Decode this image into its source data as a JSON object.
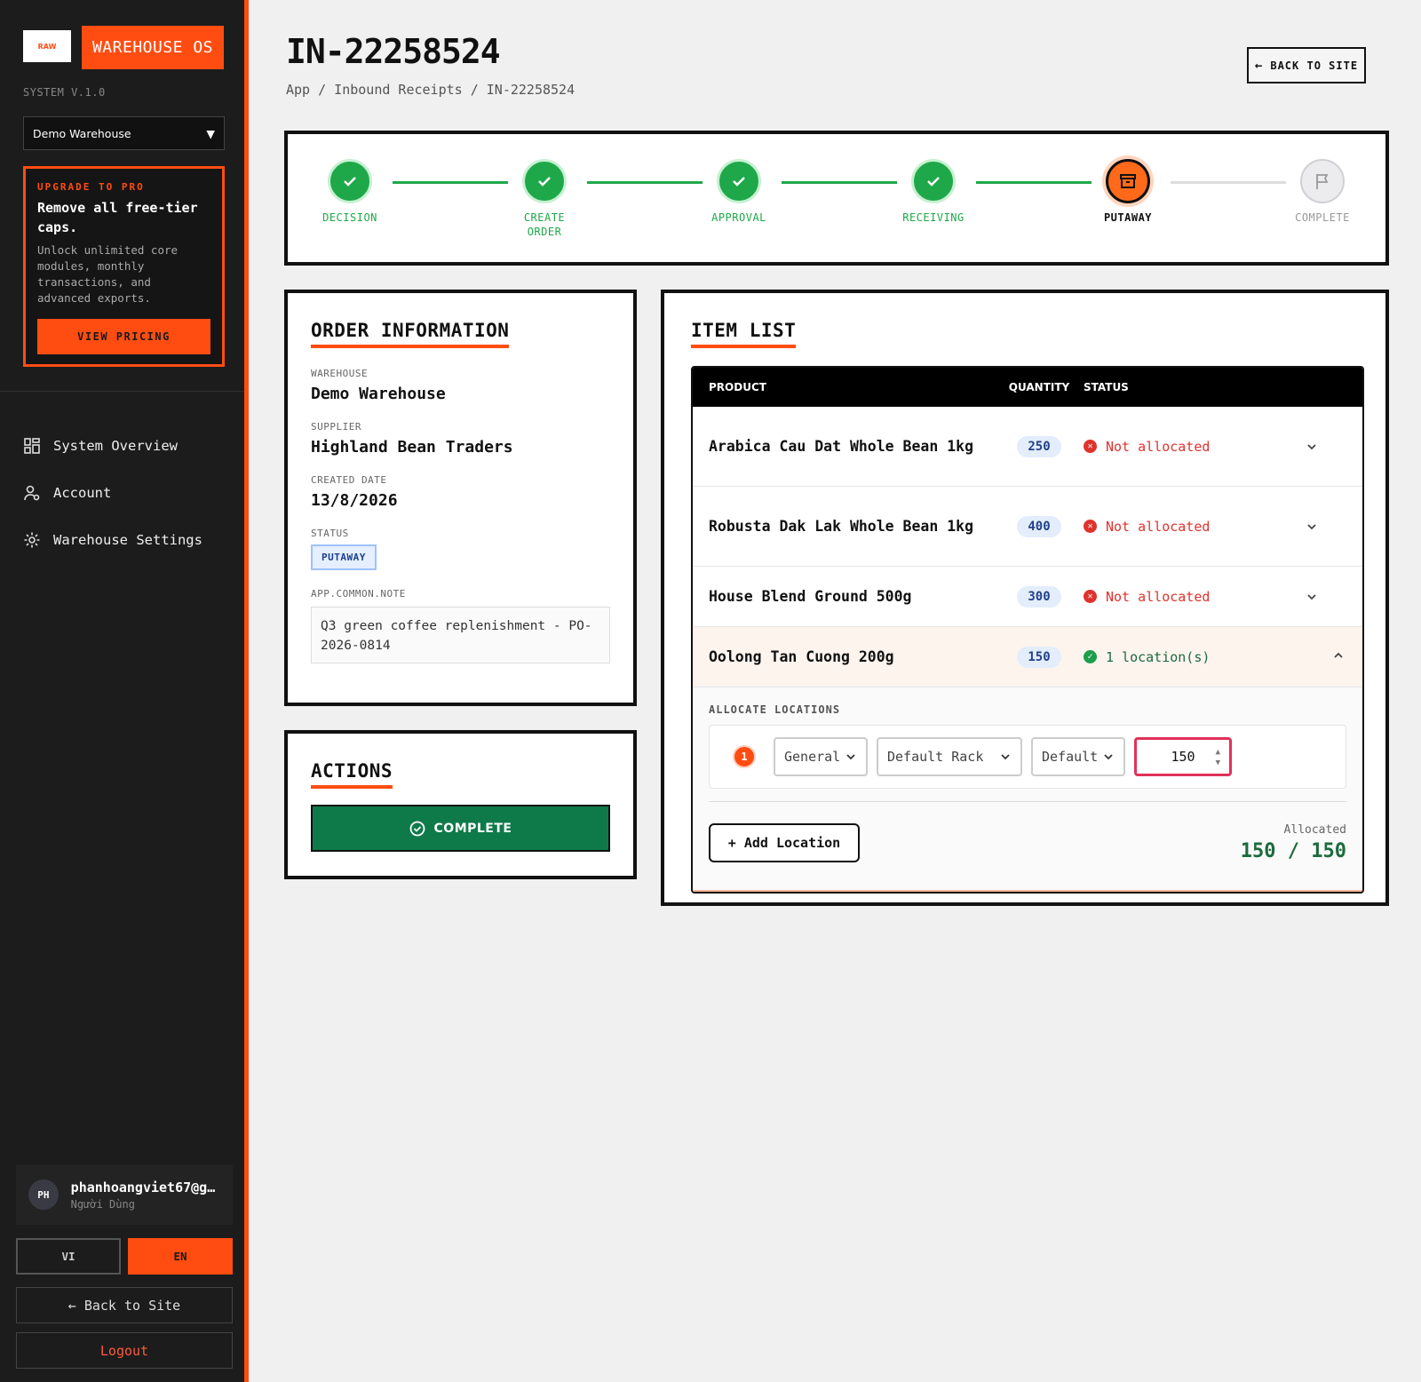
{
  "sidebar": {
    "logo_text": "RAW",
    "brand": "WAREHOUSE OS",
    "version": "SYSTEM V.1.0",
    "warehouse_select": "Demo Warehouse",
    "upgrade": {
      "kicker": "UPGRADE TO PRO",
      "headline": "Remove all free-tier caps.",
      "body": "Unlock unlimited core modules, monthly transactions, and advanced exports.",
      "button": "VIEW PRICING"
    },
    "nav": [
      {
        "label": "System Overview",
        "icon": "grid-icon"
      },
      {
        "label": "Account",
        "icon": "user-gear-icon"
      },
      {
        "label": "Warehouse Settings",
        "icon": "gear-icon"
      }
    ],
    "user": {
      "initials": "PH",
      "email": "phanhoangviet67@g…",
      "role": "Người Dùng"
    },
    "lang_vi": "VI",
    "lang_en": "EN",
    "back_to_site": "← Back to Site",
    "logout": "Logout"
  },
  "header": {
    "title": "IN-22258524",
    "breadcrumb": "App / Inbound Receipts / IN-22258524",
    "back_button": "BACK TO SITE"
  },
  "stepper": {
    "steps": [
      {
        "label": "DECISION",
        "state": "done"
      },
      {
        "label": "CREATE\nORDER",
        "state": "done"
      },
      {
        "label": "APPROVAL",
        "state": "done"
      },
      {
        "label": "RECEIVING",
        "state": "done"
      },
      {
        "label": "PUTAWAY",
        "state": "current"
      },
      {
        "label": "COMPLETE",
        "state": "todo"
      }
    ]
  },
  "order_info": {
    "title": "ORDER INFORMATION",
    "warehouse_label": "WAREHOUSE",
    "warehouse": "Demo Warehouse",
    "supplier_label": "SUPPLIER",
    "supplier": "Highland Bean Traders",
    "created_label": "CREATED DATE",
    "created": "13/8/2026",
    "status_label": "STATUS",
    "status": "PUTAWAY",
    "note_label": "APP.COMMON.NOTE",
    "note": "Q3 green coffee replenishment - PO-2026-0814"
  },
  "actions": {
    "title": "ACTIONS",
    "complete": "COMPLETE"
  },
  "items": {
    "title": "ITEM LIST",
    "columns": {
      "product": "PRODUCT",
      "quantity": "QUANTITY",
      "status": "STATUS"
    },
    "rows": [
      {
        "product": "Arabica Cau Dat Whole Bean 1kg",
        "qty": "250",
        "status": "Not allocated"
      },
      {
        "product": "Robusta Dak Lak Whole Bean 1kg",
        "qty": "400",
        "status": "Not allocated"
      },
      {
        "product": "House Blend Ground 500g",
        "qty": "300",
        "status": "Not allocated"
      },
      {
        "product": "Oolong Tan Cuong 200g",
        "qty": "150",
        "status": "1 location(s)"
      }
    ],
    "allocate": {
      "label": "ALLOCATE LOCATIONS",
      "index": "1",
      "zone": "General",
      "rack": "Default Rack",
      "bin": "Default",
      "quantity": "150",
      "add_location": "+ Add Location",
      "allocated_label": "Allocated",
      "allocated_value": "150 / 150"
    }
  },
  "colors": {
    "accent": "#ff4d12",
    "success": "#1fa84a",
    "complete_btn": "#0e7a4a",
    "danger": "#e0322d"
  }
}
